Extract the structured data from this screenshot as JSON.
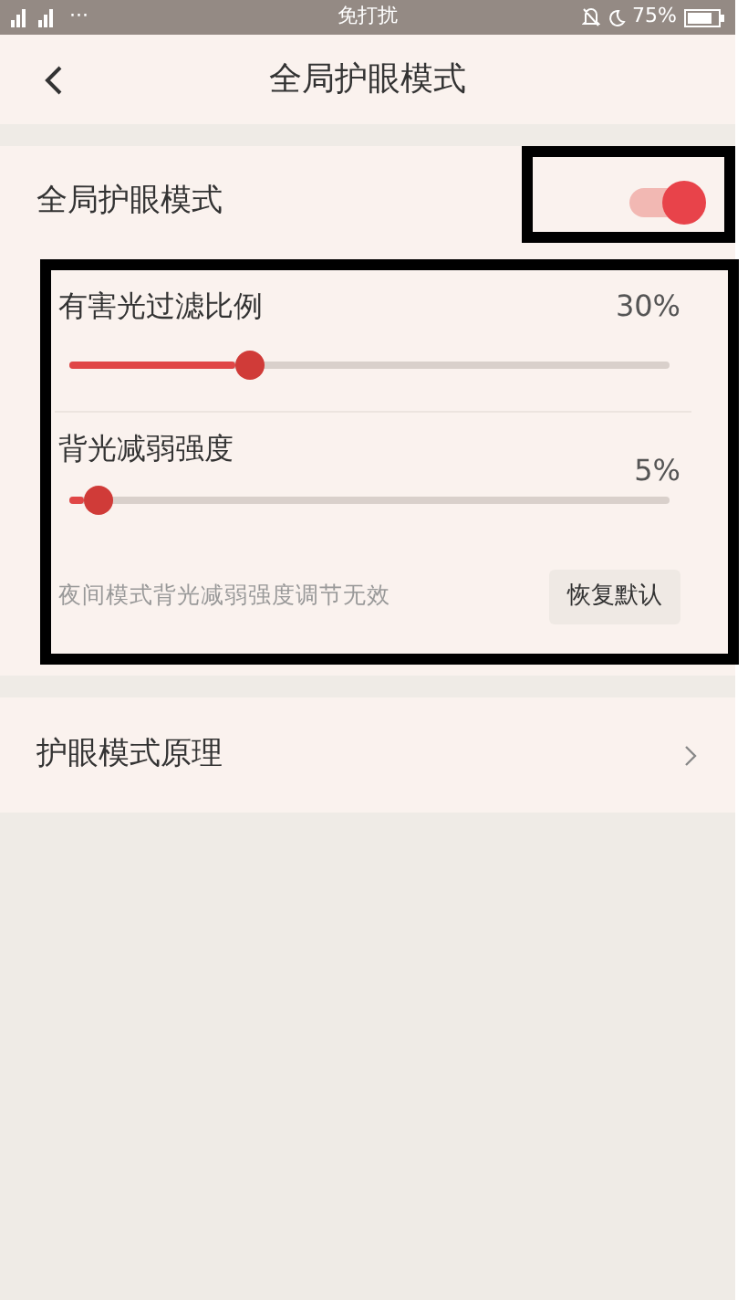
{
  "status_bar": {
    "dots": "···",
    "center": "免打扰",
    "battery_text": "75%"
  },
  "header": {
    "title": "全局护眼模式"
  },
  "main_toggle": {
    "label": "全局护眼模式",
    "on": true,
    "highlighted": true
  },
  "slider_panel": {
    "highlighted": true,
    "sliders": [
      {
        "label": "有害光过滤比例",
        "reading": "30%",
        "level": 0.3
      },
      {
        "label": "背光减弱强度",
        "reading": "5%",
        "level": 0.05
      }
    ],
    "note": "夜间模式背光减弱强度调节无效",
    "reset_button": "恢复默认"
  },
  "links": [
    {
      "label": "护眼模式原理"
    }
  ]
}
